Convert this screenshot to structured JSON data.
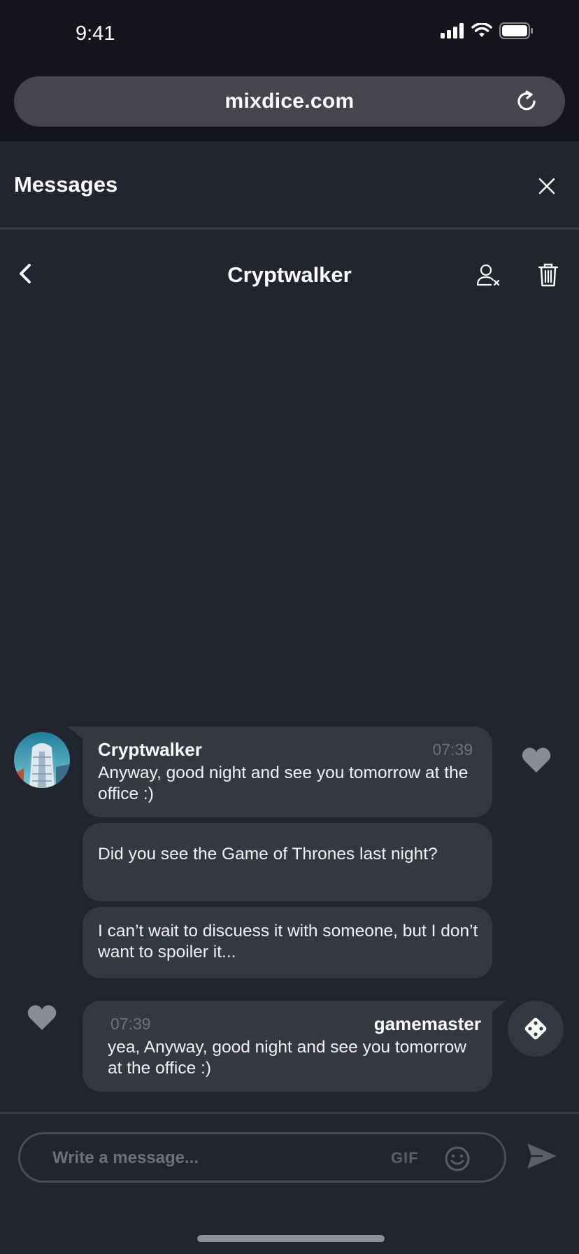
{
  "status_bar": {
    "time": "9:41"
  },
  "browser": {
    "url": "mixdice.com"
  },
  "messages_panel": {
    "title": "Messages"
  },
  "conversation": {
    "title": "Cryptwalker",
    "messages": [
      {
        "sender": "Cryptwalker",
        "time": "07:39",
        "text": "Anyway, good night and see you tomorrow at the office :)"
      },
      {
        "text": "Did you see the Game of Thrones last night?"
      },
      {
        "text": "I can’t wait to discuess it with someone, but I don’t want to spoiler it..."
      },
      {
        "sender": "gamemaster",
        "time": "07:39",
        "text": "yea, Anyway, good night and see you tomorrow at the office :)"
      }
    ]
  },
  "composer": {
    "placeholder": "Write a message...",
    "gif_label": "GIF"
  },
  "icons": {
    "reload": "reload-icon",
    "close": "close-icon",
    "back": "chevron-left-icon",
    "block_user": "user-remove-icon",
    "delete": "trash-icon",
    "heart": "heart-icon",
    "dice": "dice-icon",
    "emoji": "emoji-icon",
    "send": "send-icon"
  },
  "colors": {
    "background": "#22242f",
    "chrome": "#14151c",
    "bubble": "#353743",
    "muted_text": "#6e717d"
  }
}
